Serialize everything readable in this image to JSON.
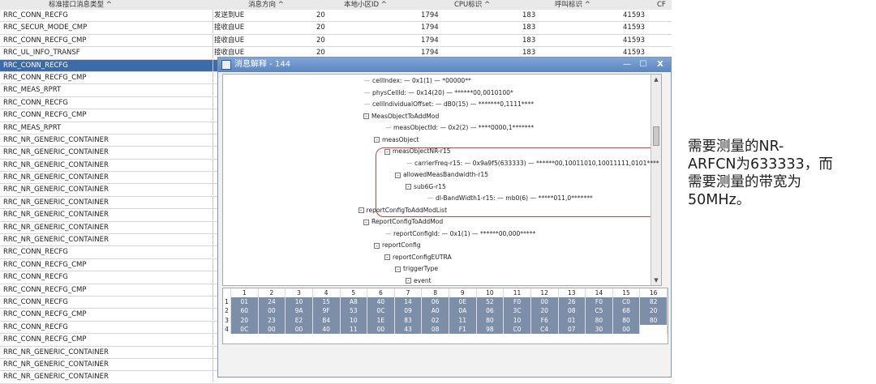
{
  "columns": [
    "标准接口消息类型 ^",
    "消息方向 ^",
    "本地小区ID ^",
    "CPU标识 ^",
    "呼叫标识 ^",
    "CF"
  ],
  "rows": [
    {
      "type": "RRC_CONN_RECFG",
      "dir": "发送到UE",
      "cell": "20",
      "cpu": "1794",
      "call": "183",
      "x": "41593"
    },
    {
      "type": "RRC_SECUR_MODE_CMP",
      "dir": "接收自UE",
      "cell": "20",
      "cpu": "1794",
      "call": "183",
      "x": "41593"
    },
    {
      "type": "RRC_CONN_RECFG_CMP",
      "dir": "接收自UE",
      "cell": "20",
      "cpu": "1794",
      "call": "183",
      "x": "41593"
    },
    {
      "type": "RRC_UL_INFO_TRANSF",
      "dir": "接收自UE",
      "cell": "20",
      "cpu": "1794",
      "call": "183",
      "x": "41593"
    },
    {
      "type": "RRC_CONN_RECFG",
      "dir": "",
      "cell": "",
      "cpu": "",
      "call": "",
      "x": ""
    },
    {
      "type": "RRC_CONN_RECFG_CMP",
      "dir": "",
      "cell": "",
      "cpu": "",
      "call": "",
      "x": ""
    },
    {
      "type": "RRC_MEAS_RPRT",
      "dir": "",
      "cell": "",
      "cpu": "",
      "call": "",
      "x": ""
    },
    {
      "type": "RRC_CONN_RECFG",
      "dir": "",
      "cell": "",
      "cpu": "",
      "call": "",
      "x": ""
    },
    {
      "type": "RRC_CONN_RECFG_CMP",
      "dir": "",
      "cell": "",
      "cpu": "",
      "call": "",
      "x": ""
    },
    {
      "type": "RRC_MEAS_RPRT",
      "dir": "",
      "cell": "",
      "cpu": "",
      "call": "",
      "x": ""
    },
    {
      "type": "RRC_NR_GENERIC_CONTAINER",
      "dir": "",
      "cell": "",
      "cpu": "",
      "call": "",
      "x": ""
    },
    {
      "type": "RRC_NR_GENERIC_CONTAINER",
      "dir": "",
      "cell": "",
      "cpu": "",
      "call": "",
      "x": ""
    },
    {
      "type": "RRC_NR_GENERIC_CONTAINER",
      "dir": "",
      "cell": "",
      "cpu": "",
      "call": "",
      "x": ""
    },
    {
      "type": "RRC_NR_GENERIC_CONTAINER",
      "dir": "",
      "cell": "",
      "cpu": "",
      "call": "",
      "x": ""
    },
    {
      "type": "RRC_NR_GENERIC_CONTAINER",
      "dir": "",
      "cell": "",
      "cpu": "",
      "call": "",
      "x": ""
    },
    {
      "type": "RRC_NR_GENERIC_CONTAINER",
      "dir": "",
      "cell": "",
      "cpu": "",
      "call": "",
      "x": ""
    },
    {
      "type": "RRC_NR_GENERIC_CONTAINER",
      "dir": "",
      "cell": "",
      "cpu": "",
      "call": "",
      "x": ""
    },
    {
      "type": "RRC_NR_GENERIC_CONTAINER",
      "dir": "",
      "cell": "",
      "cpu": "",
      "call": "",
      "x": ""
    },
    {
      "type": "RRC_NR_GENERIC_CONTAINER",
      "dir": "",
      "cell": "",
      "cpu": "",
      "call": "",
      "x": ""
    },
    {
      "type": "RRC_CONN_RECFG",
      "dir": "",
      "cell": "",
      "cpu": "",
      "call": "",
      "x": ""
    },
    {
      "type": "RRC_CONN_RECFG_CMP",
      "dir": "",
      "cell": "",
      "cpu": "",
      "call": "",
      "x": ""
    },
    {
      "type": "RRC_CONN_RECFG",
      "dir": "",
      "cell": "",
      "cpu": "",
      "call": "",
      "x": ""
    },
    {
      "type": "RRC_CONN_RECFG_CMP",
      "dir": "",
      "cell": "",
      "cpu": "",
      "call": "",
      "x": ""
    },
    {
      "type": "RRC_CONN_RECFG",
      "dir": "",
      "cell": "",
      "cpu": "",
      "call": "",
      "x": ""
    },
    {
      "type": "RRC_CONN_RECFG_CMP",
      "dir": "",
      "cell": "",
      "cpu": "",
      "call": "",
      "x": ""
    },
    {
      "type": "RRC_CONN_RECFG",
      "dir": "",
      "cell": "",
      "cpu": "",
      "call": "",
      "x": ""
    },
    {
      "type": "RRC_CONN_RECFG_CMP",
      "dir": "",
      "cell": "",
      "cpu": "",
      "call": "",
      "x": ""
    },
    {
      "type": "RRC_NR_GENERIC_CONTAINER",
      "dir": "",
      "cell": "",
      "cpu": "",
      "call": "",
      "x": ""
    },
    {
      "type": "RRC_NR_GENERIC_CONTAINER",
      "dir": "",
      "cell": "",
      "cpu": "",
      "call": "",
      "x": ""
    },
    {
      "type": "RRC_NR_GENERIC_CONTAINER",
      "dir": "",
      "cell": "",
      "cpu": "",
      "call": "",
      "x": ""
    }
  ],
  "selected_row": 4,
  "dialog": {
    "title": "消息解释 - 144",
    "minimize": "—",
    "maximize": "☐",
    "close": "X"
  },
  "tree": [
    {
      "indent": 0,
      "text": "cellIndex: — 0x1(1) — *00000**",
      "lead": true
    },
    {
      "indent": 0,
      "text": "physCellId: — 0x14(20) — ******00,0010100*",
      "lead": true
    },
    {
      "indent": 0,
      "text": "cellIndividualOffset: — dB0(15) — *******0,1111****",
      "lead": true
    },
    {
      "indent": 1,
      "text": "MeasObjectToAddMod",
      "toggle": "-"
    },
    {
      "indent": 2,
      "text": "measObjectId: — 0x2(2) — ****0000,1*******",
      "lead": true
    },
    {
      "indent": 2,
      "text": "measObject",
      "toggle": "-"
    },
    {
      "indent": 3,
      "text": "measObjectNR-r15",
      "toggle": "-"
    },
    {
      "indent": 4,
      "text": "carrierFreq-r15: — 0x9a9f5(633333) — ******00,10011010,10011111,0101****",
      "lead": true
    },
    {
      "indent": 4,
      "text": "allowedMeasBandwidth-r15",
      "toggle": "-"
    },
    {
      "indent": 5,
      "text": "sub6G-r15",
      "toggle": "-"
    },
    {
      "indent": 6,
      "text": "dl-BandWidth1-r15: — mb0(6) — *****011,0*******",
      "lead": true
    },
    {
      "indent": 0.5,
      "text": "reportConfigToAddModList",
      "toggle": "-"
    },
    {
      "indent": 1,
      "text": "ReportConfigToAddMod",
      "toggle": "-"
    },
    {
      "indent": 2,
      "text": "reportConfigId: — 0x1(1) — ******00,000*****",
      "lead": true
    },
    {
      "indent": 2,
      "text": "reportConfig",
      "toggle": "-"
    },
    {
      "indent": 3,
      "text": "reportConfigEUTRA",
      "toggle": "-"
    },
    {
      "indent": 4,
      "text": "triggerType",
      "toggle": "-"
    },
    {
      "indent": 5,
      "text": "event",
      "toggle": "-"
    }
  ],
  "hex": {
    "header": [
      "1",
      "2",
      "3",
      "4",
      "5",
      "6",
      "7",
      "8",
      "9",
      "10",
      "11",
      "12",
      "13",
      "14",
      "15",
      "16"
    ],
    "rows": [
      {
        "n": "1",
        "v": [
          "01",
          "24",
          "10",
          "15",
          "A8",
          "40",
          "14",
          "06",
          "0E",
          "52",
          "F0",
          "00",
          "26",
          "F0",
          "C0",
          "82"
        ]
      },
      {
        "n": "2",
        "v": [
          "60",
          "00",
          "9A",
          "9F",
          "53",
          "0C",
          "09",
          "A0",
          "0A",
          "06",
          "3C",
          "20",
          "08",
          "C5",
          "68",
          "20"
        ]
      },
      {
        "n": "3",
        "v": [
          "20",
          "23",
          "E2",
          "B4",
          "10",
          "1E",
          "83",
          "02",
          "11",
          "80",
          "10",
          "F6",
          "01",
          "80",
          "80",
          "80"
        ]
      },
      {
        "n": "4",
        "v": [
          "0C",
          "00",
          "00",
          "40",
          "11",
          "00",
          "43",
          "08",
          "F1",
          "98",
          "C0",
          "C4",
          "07",
          "30",
          "00",
          ""
        ]
      }
    ]
  },
  "annotation": [
    "需要测量的NR-",
    "ARFCN为633333，而",
    "需要测量的带宽为",
    "50MHz。"
  ]
}
